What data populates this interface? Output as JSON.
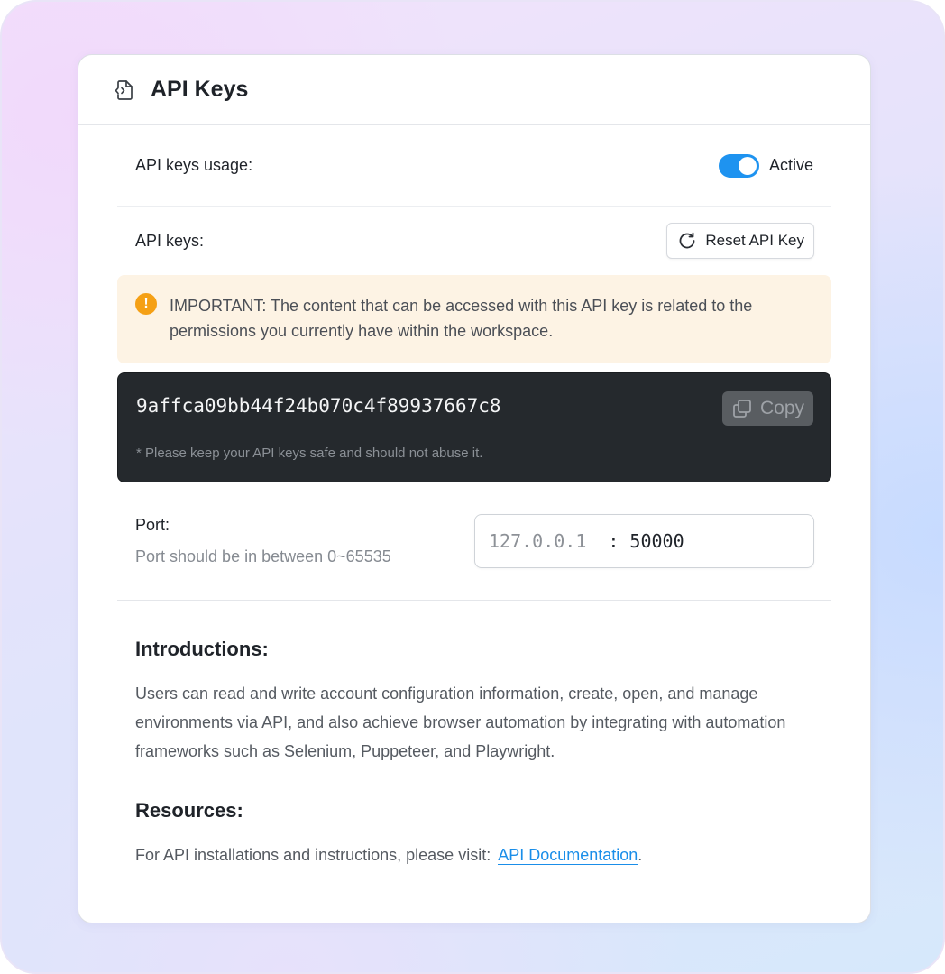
{
  "header": {
    "title": "API Keys",
    "icon": "code-file-icon"
  },
  "usage": {
    "label": "API keys usage:",
    "toggle_on": true,
    "status": "Active"
  },
  "keys": {
    "label": "API keys:",
    "reset_label": "Reset API Key",
    "warning": "IMPORTANT: The content that can be accessed with this API key is related to the permissions you currently have within the workspace.",
    "warning_icon": "!",
    "key": "9affca09bb44f24b070c4f89937667c8",
    "copy_label": "Copy",
    "note": "* Please keep your API keys safe and should not abuse it."
  },
  "port": {
    "title": "Port:",
    "hint": "Port should be in between 0~65535",
    "host": "127.0.0.1",
    "separator": ":",
    "value": "50000"
  },
  "introductions": {
    "heading": "Introductions:",
    "text": "Users can read and write account configuration information, create, open, and manage environments via API, and also achieve browser automation by integrating with automation frameworks such as Selenium, Puppeteer, and Playwright."
  },
  "resources": {
    "heading": "Resources:",
    "text": "For API installations and instructions, please visit:",
    "link_label": "API Documentation",
    "suffix": "."
  },
  "colors": {
    "accent": "#1e93f0",
    "warning_bg": "#fdf3e4",
    "warning_icon": "#f5a015",
    "key_bg": "#25292d",
    "link": "#1a8ee9"
  }
}
